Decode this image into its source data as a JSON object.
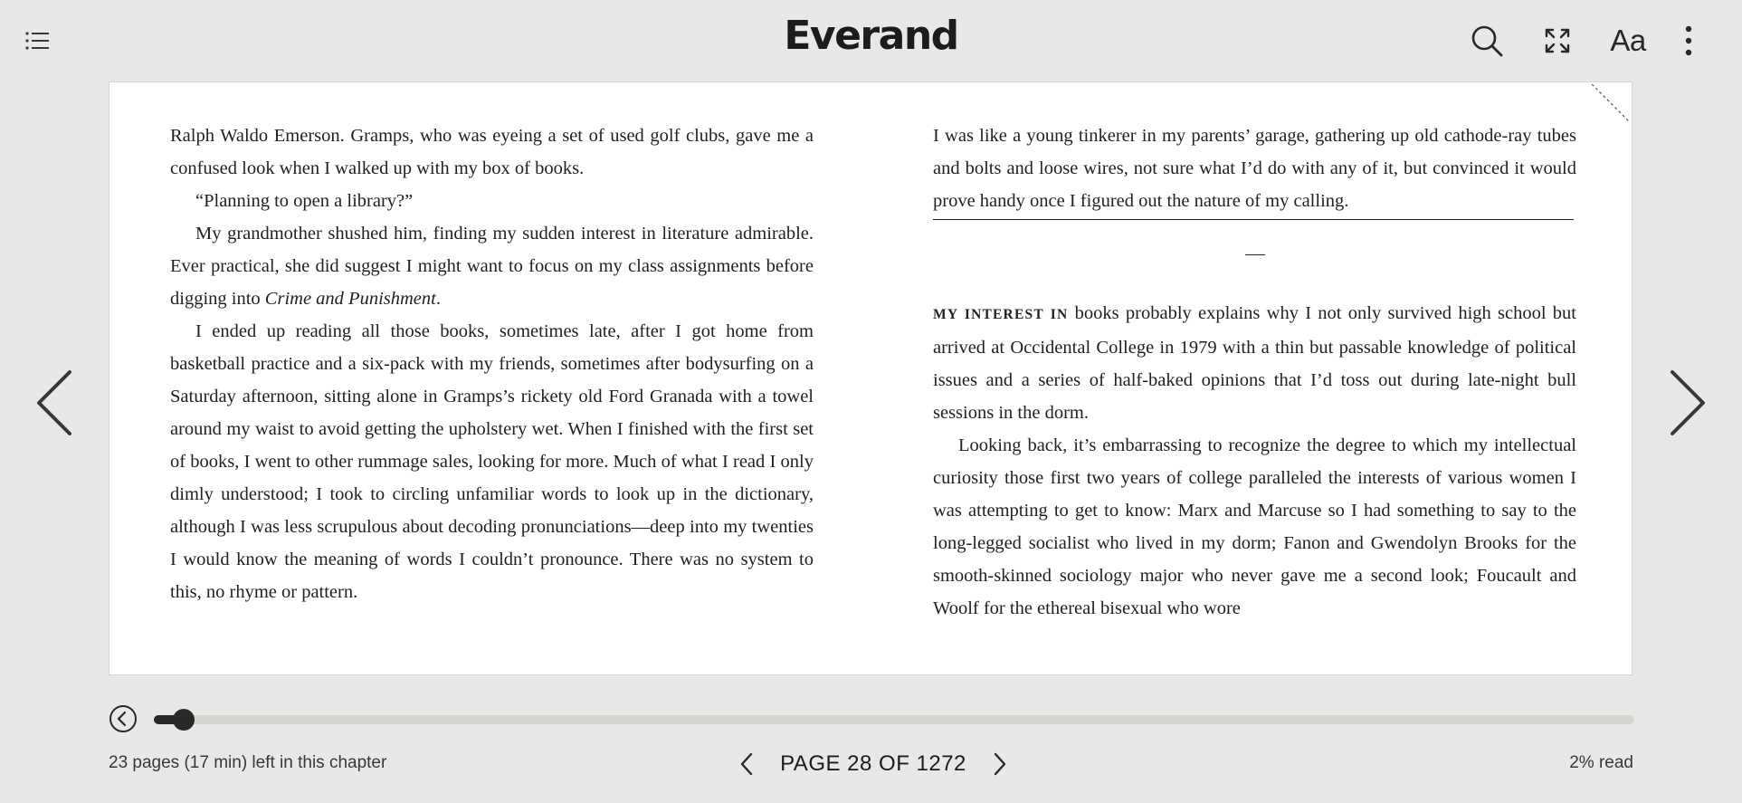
{
  "app": {
    "brand": "Everand"
  },
  "icons": {
    "toc": "list-icon",
    "search": "search-icon",
    "fullscreen": "fullscreen-icon",
    "font_settings_label": "Aa",
    "more": "more-vertical-icon",
    "prev_page": "chevron-left-icon",
    "next_page": "chevron-right-icon",
    "back_to_position": "back-circle-icon"
  },
  "book": {
    "left_column": {
      "p1": "Ralph Waldo Emerson. Gramps, who was eyeing a set of used golf clubs, gave me a confused look when I walked up with my box of books.",
      "p2": "“Planning to open a library?”",
      "p3_before": "My grandmother shushed him, finding my sudden interest in literature admirable. Ever practical, she did suggest I might want to focus on my class assignments before digging into ",
      "p3_italic": "Crime and Punishment",
      "p3_after": ".",
      "p4": "I ended up reading all those books, sometimes late, after I got home from basketball practice and a six-pack with my friends, sometimes after bodysurfing on a Saturday afternoon, sitting alone in Gramps’s rickety old Ford Granada with a towel around my waist to avoid getting the upholstery wet. When I finished with the first set of books, I went to other rummage sales, looking for more. Much of what I read I only dimly understood; I took to circling unfamiliar words to look up in the dictionary, although I was less scrupulous about decoding pronunciations—deep into my twenties I would know the meaning of words I couldn’t pronounce. There was no system to this, no rhyme or pattern."
    },
    "right_column": {
      "p1": "I was like a young tinkerer in my parents’ garage, gathering up old cathode-ray tubes and bolts and loose wires, not sure what I’d do with any of it, but convinced it would prove handy once I figured out the nature of my calling.",
      "p2_lead": "MY INTEREST IN",
      "p2_rest": " books probably explains why I not only survived high school but arrived at Occidental College in 1979 with a thin but passable knowledge of political issues and a series of half-baked opinions that I’d toss out during late-night bull sessions in the dorm.",
      "p3": "Looking back, it’s embarrassing to recognize the degree to which my intellectual curiosity those first two years of college paralleled the interests of various women I was attempting to get to know: Marx and Marcuse so I had something to say to the long-legged socialist who lived in my dorm; Fanon and Gwendolyn Brooks for the smooth-skinned sociology major who never gave me a second look; Foucault and Woolf for the ethereal bisexual who wore"
    }
  },
  "footer": {
    "chapter_remaining": "23 pages (17 min) left in this chapter",
    "page_indicator": "PAGE 28 OF 1272",
    "percent_read": "2% read",
    "progress": 0.02
  },
  "colors": {
    "background": "#e9e8e6",
    "page": "#ffffff",
    "ink": "#1e1c1a",
    "track": "#d6d4d1"
  }
}
